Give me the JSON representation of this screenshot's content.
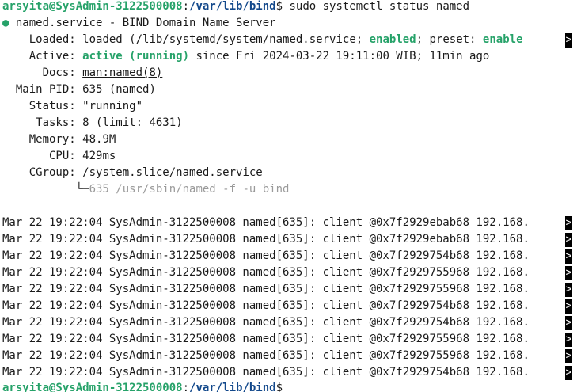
{
  "prompt_top": {
    "user_host": "arsyita@SysAdmin-3122500008",
    "sep": ":",
    "path": "/var/lib/bind",
    "dollar": "$",
    "command": " sudo systemctl status named"
  },
  "unit": {
    "bullet": "●",
    "title": " named.service - BIND Domain Name Server"
  },
  "fields": {
    "loaded_label": "    Loaded: ",
    "loaded_value_a": "loaded (",
    "loaded_value_path": "/lib/systemd/system/named.service",
    "loaded_value_b": "; ",
    "loaded_enabled": "enabled",
    "loaded_value_c": "; preset: ",
    "loaded_preset": "enable",
    "active_label": "    Active: ",
    "active_state": "active (running)",
    "active_since": " since Fri 2024-03-22 19:11:00 WIB; 11min ago",
    "docs_label": "      Docs: ",
    "docs_value": "man:named(8)",
    "pid_label": "  Main PID: ",
    "pid_value": "635 (named)",
    "status_label": "    Status: ",
    "status_value": "\"running\"",
    "tasks_label": "     Tasks: ",
    "tasks_value": "8 (limit: 4631)",
    "memory_label": "    Memory: ",
    "memory_value": "48.9M",
    "cpu_label": "       CPU: ",
    "cpu_value": "429ms",
    "cgroup_label": "    CGroup: ",
    "cgroup_value": "/system.slice/named.service",
    "tree_branch": "           └─",
    "tree_process": "635 /usr/sbin/named -f -u bind"
  },
  "log_lines": [
    "Mar 22 19:22:04 SysAdmin-3122500008 named[635]: client @0x7f2929ebab68 192.168.",
    "Mar 22 19:22:04 SysAdmin-3122500008 named[635]: client @0x7f2929ebab68 192.168.",
    "Mar 22 19:22:04 SysAdmin-3122500008 named[635]: client @0x7f2929754b68 192.168.",
    "Mar 22 19:22:04 SysAdmin-3122500008 named[635]: client @0x7f2929755968 192.168.",
    "Mar 22 19:22:04 SysAdmin-3122500008 named[635]: client @0x7f2929755968 192.168.",
    "Mar 22 19:22:04 SysAdmin-3122500008 named[635]: client @0x7f2929754b68 192.168.",
    "Mar 22 19:22:04 SysAdmin-3122500008 named[635]: client @0x7f2929754b68 192.168.",
    "Mar 22 19:22:04 SysAdmin-3122500008 named[635]: client @0x7f2929755968 192.168.",
    "Mar 22 19:22:04 SysAdmin-3122500008 named[635]: client @0x7f2929755968 192.168.",
    "Mar 22 19:22:04 SysAdmin-3122500008 named[635]: client @0x7f2929754b68 192.168."
  ],
  "truncation_marker": ">",
  "prompt_bottom": {
    "user_host": "arsyita@SysAdmin-3122500008",
    "sep": ":",
    "path": "/var/lib/bind",
    "dollar": "$"
  },
  "colors": {
    "green": "#26a269",
    "path_blue": "#12488b",
    "gray": "#9a9a9a",
    "background": "#ffffff"
  }
}
